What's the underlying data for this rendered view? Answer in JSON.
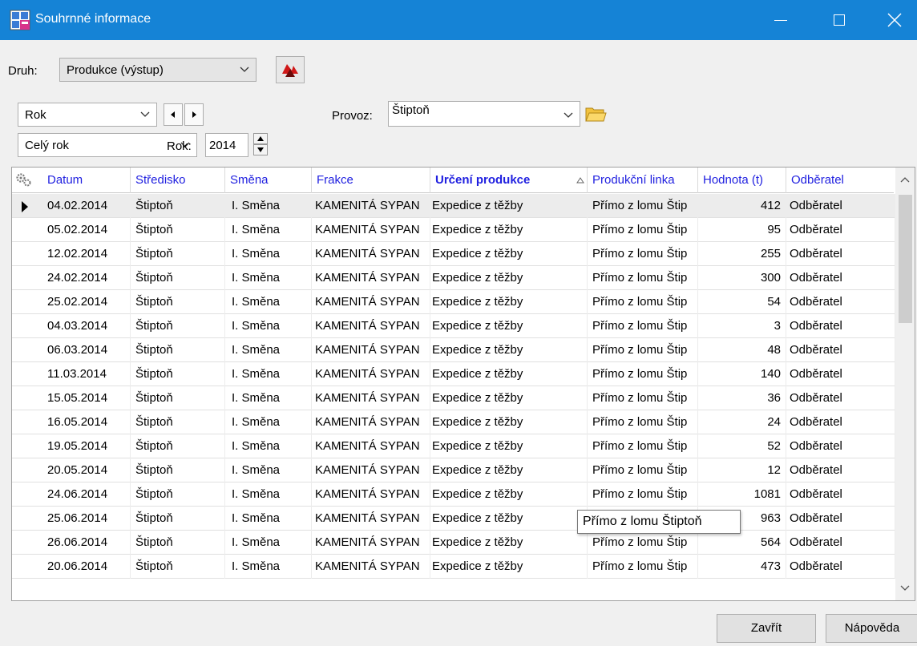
{
  "window": {
    "title": "Souhrnné informace",
    "accent": "#1583d6"
  },
  "toolbar": {
    "druh_label": "Druh:",
    "druh_value": "Produkce (výstup)"
  },
  "filters": {
    "period_type": "Rok",
    "period_range": "Celý rok",
    "rok_label": "Rok:",
    "rok_value": "2014",
    "provoz_label": "Provoz:",
    "provoz_value": "Štiptoň"
  },
  "table": {
    "columns": [
      "Datum",
      "Středisko",
      "Směna",
      "Frakce",
      "Určení produkce",
      "Produkční linka",
      "Hodnota (t)",
      "Odběratel"
    ],
    "sorted_column": "Určení produkce",
    "rows": [
      [
        "04.02.2014",
        "Štiptoň",
        "I. Směna",
        "KAMENITÁ SYPAN",
        "Expedice z těžby",
        "Přímo z lomu Štip",
        "412",
        "Odběratel"
      ],
      [
        "05.02.2014",
        "Štiptoň",
        "I. Směna",
        "KAMENITÁ SYPAN",
        "Expedice z těžby",
        "Přímo z lomu Štip",
        "95",
        "Odběratel"
      ],
      [
        "12.02.2014",
        "Štiptoň",
        "I. Směna",
        "KAMENITÁ SYPAN",
        "Expedice z těžby",
        "Přímo z lomu Štip",
        "255",
        "Odběratel"
      ],
      [
        "24.02.2014",
        "Štiptoň",
        "I. Směna",
        "KAMENITÁ SYPAN",
        "Expedice z těžby",
        "Přímo z lomu Štip",
        "300",
        "Odběratel"
      ],
      [
        "25.02.2014",
        "Štiptoň",
        "I. Směna",
        "KAMENITÁ SYPAN",
        "Expedice z těžby",
        "Přímo z lomu Štip",
        "54",
        "Odběratel"
      ],
      [
        "04.03.2014",
        "Štiptoň",
        "I. Směna",
        "KAMENITÁ SYPAN",
        "Expedice z těžby",
        "Přímo z lomu Štip",
        "3",
        "Odběratel"
      ],
      [
        "06.03.2014",
        "Štiptoň",
        "I. Směna",
        "KAMENITÁ SYPAN",
        "Expedice z těžby",
        "Přímo z lomu Štip",
        "48",
        "Odběratel"
      ],
      [
        "11.03.2014",
        "Štiptoň",
        "I. Směna",
        "KAMENITÁ SYPAN",
        "Expedice z těžby",
        "Přímo z lomu Štip",
        "140",
        "Odběratel"
      ],
      [
        "15.05.2014",
        "Štiptoň",
        "I. Směna",
        "KAMENITÁ SYPAN",
        "Expedice z těžby",
        "Přímo z lomu Štip",
        "36",
        "Odběratel"
      ],
      [
        "16.05.2014",
        "Štiptoň",
        "I. Směna",
        "KAMENITÁ SYPAN",
        "Expedice z těžby",
        "Přímo z lomu Štip",
        "24",
        "Odběratel"
      ],
      [
        "19.05.2014",
        "Štiptoň",
        "I. Směna",
        "KAMENITÁ SYPAN",
        "Expedice z těžby",
        "Přímo z lomu Štip",
        "52",
        "Odběratel"
      ],
      [
        "20.05.2014",
        "Štiptoň",
        "I. Směna",
        "KAMENITÁ SYPAN",
        "Expedice z těžby",
        "Přímo z lomu Štip",
        "12",
        "Odběratel"
      ],
      [
        "24.06.2014",
        "Štiptoň",
        "I. Směna",
        "KAMENITÁ SYPAN",
        "Expedice z těžby",
        "Přímo z lomu Štip",
        "1081",
        "Odběratel"
      ],
      [
        "25.06.2014",
        "Štiptoň",
        "I. Směna",
        "KAMENITÁ SYPAN",
        "Expedice z těžby",
        "Přímo z lomu Štip",
        "963",
        "Odběratel"
      ],
      [
        "26.06.2014",
        "Štiptoň",
        "I. Směna",
        "KAMENITÁ SYPAN",
        "Expedice z těžby",
        "Přímo z lomu Štip",
        "564",
        "Odběratel"
      ],
      [
        "20.06.2014",
        "Štiptoň",
        "I. Směna",
        "KAMENITÁ SYPAN",
        "Expedice z těžby",
        "Přímo z lomu Štip",
        "473",
        "Odběratel"
      ]
    ]
  },
  "tooltip": "Přímo z lomu Štiptoň",
  "buttons": {
    "close": "Zavřít",
    "help": "Nápověda"
  }
}
